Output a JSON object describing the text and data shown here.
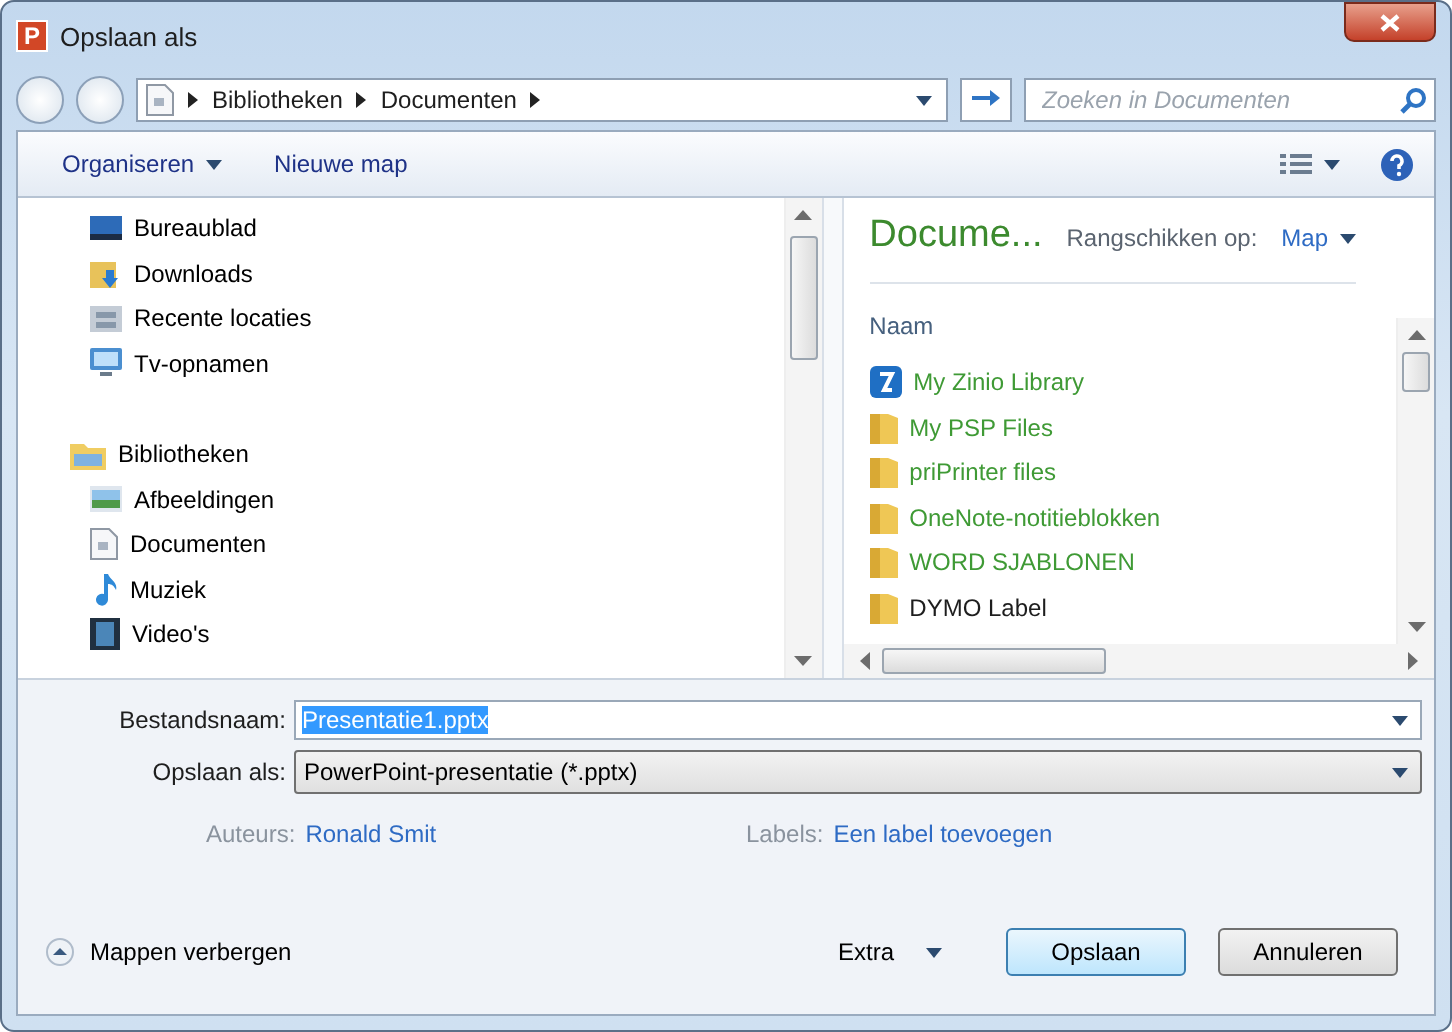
{
  "window": {
    "icon_letter": "P",
    "title": "Opslaan als"
  },
  "address": {
    "segments": [
      "Bibliotheken",
      "Documenten"
    ]
  },
  "search": {
    "placeholder": "Zoeken in Documenten"
  },
  "toolbar": {
    "organize": "Organiseren",
    "new_folder": "Nieuwe map"
  },
  "navigation": [
    {
      "label": "Bureaublad",
      "kind": "desktop"
    },
    {
      "label": "Downloads",
      "kind": "downloads"
    },
    {
      "label": "Recente locaties",
      "kind": "recent"
    },
    {
      "label": "Tv-opnamen",
      "kind": "tv"
    },
    {
      "label": "Bibliotheken",
      "kind": "library",
      "children": [
        {
          "label": "Afbeeldingen",
          "kind": "pictures"
        },
        {
          "label": "Documenten",
          "kind": "documents"
        },
        {
          "label": "Muziek",
          "kind": "music"
        },
        {
          "label": "Video's",
          "kind": "video"
        }
      ]
    }
  ],
  "library": {
    "title": "Docume...",
    "arrange_label": "Rangschikken op:",
    "arrange_value": "Map",
    "column": "Naam"
  },
  "files": [
    {
      "name": "My Zinio Library",
      "kind": "app",
      "color": "#3f9a35"
    },
    {
      "name": "My PSP Files",
      "kind": "folder",
      "color": "#3f9a35"
    },
    {
      "name": "priPrinter files",
      "kind": "folder",
      "color": "#3f9a35"
    },
    {
      "name": "OneNote-notitieblokken",
      "kind": "folder",
      "color": "#3f9a35"
    },
    {
      "name": "WORD SJABLONEN",
      "kind": "folder",
      "color": "#3f9a35"
    },
    {
      "name": "DYMO Label",
      "kind": "folder",
      "color": "#1e1e1e"
    }
  ],
  "filename": {
    "label": "Bestandsnaam:",
    "value": "Presentatie1.pptx",
    "selected": true
  },
  "save_type": {
    "label": "Opslaan als:",
    "value": "PowerPoint-presentatie (*.pptx)"
  },
  "meta": [
    {
      "label": "Auteurs:",
      "value": "Ronald Smit"
    },
    {
      "label": "Labels:",
      "value": "Een label toevoegen"
    }
  ],
  "footer": {
    "hide_folders": "Mappen verbergen",
    "tools": "Extra",
    "buttons": [
      {
        "label": "Opslaan",
        "kind": "primary"
      },
      {
        "label": "Annuleren",
        "kind": "normal"
      }
    ]
  }
}
